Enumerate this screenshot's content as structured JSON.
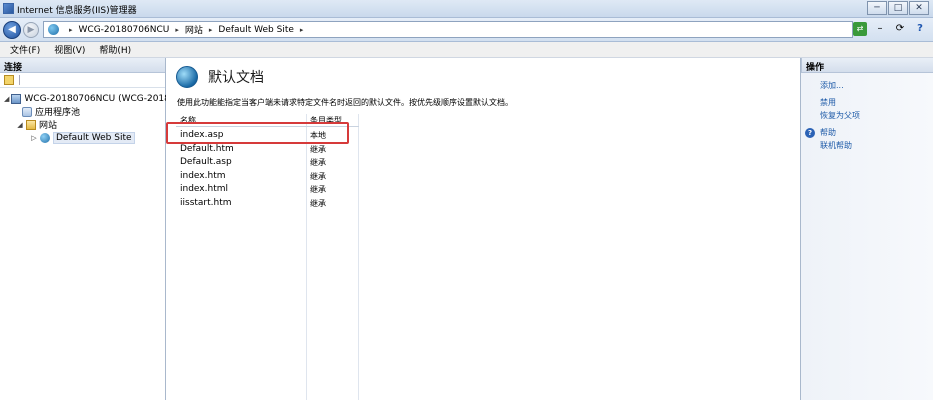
{
  "window": {
    "title": "Internet 信息服务(IIS)管理器",
    "buttons": {
      "minimize": "─",
      "maximize": "□",
      "close": "✕"
    }
  },
  "address": {
    "back": "◀",
    "forward": "▶",
    "breadcrumb": [
      "WCG-20180706NCU",
      "网站",
      "Default Web Site"
    ],
    "separator": "▸"
  },
  "toolbar_icons": [
    "connect-icon",
    "minus-icon",
    "refresh-icon",
    "help-icon"
  ],
  "menu": {
    "file": "文件(F)",
    "view": "视图(V)",
    "help": "帮助(H)"
  },
  "connections": {
    "header": "连接",
    "tree": [
      {
        "label": "WCG-20180706NCU (WCG-20180706",
        "expander": "◢",
        "icon": "server-icon"
      },
      {
        "label": "应用程序池",
        "icon": "app-pool-icon"
      },
      {
        "label": "网站",
        "expander": "◢",
        "icon": "folder-icon"
      },
      {
        "label": "Default Web Site",
        "expander": "▷",
        "icon": "globe-icon"
      }
    ]
  },
  "feature": {
    "title": "默认文档",
    "description": "使用此功能能指定当客户端未请求特定文件名时返回的默认文件。按优先级顺序设置默认文档。",
    "columns": {
      "name": "名称",
      "entry_type": "条目类型"
    },
    "rows": [
      {
        "name": "index.asp",
        "type": "本地"
      },
      {
        "name": "Default.htm",
        "type": "继承"
      },
      {
        "name": "Default.asp",
        "type": "继承"
      },
      {
        "name": "index.htm",
        "type": "继承"
      },
      {
        "name": "index.html",
        "type": "继承"
      },
      {
        "name": "iisstart.htm",
        "type": "继承"
      }
    ],
    "highlighted_row": "index.asp",
    "highlight_color": "#d63a3a"
  },
  "actions": {
    "header": "操作",
    "items": [
      "添加...",
      "禁用",
      "恢复为父项"
    ],
    "help": [
      "帮助",
      "联机帮助"
    ]
  }
}
